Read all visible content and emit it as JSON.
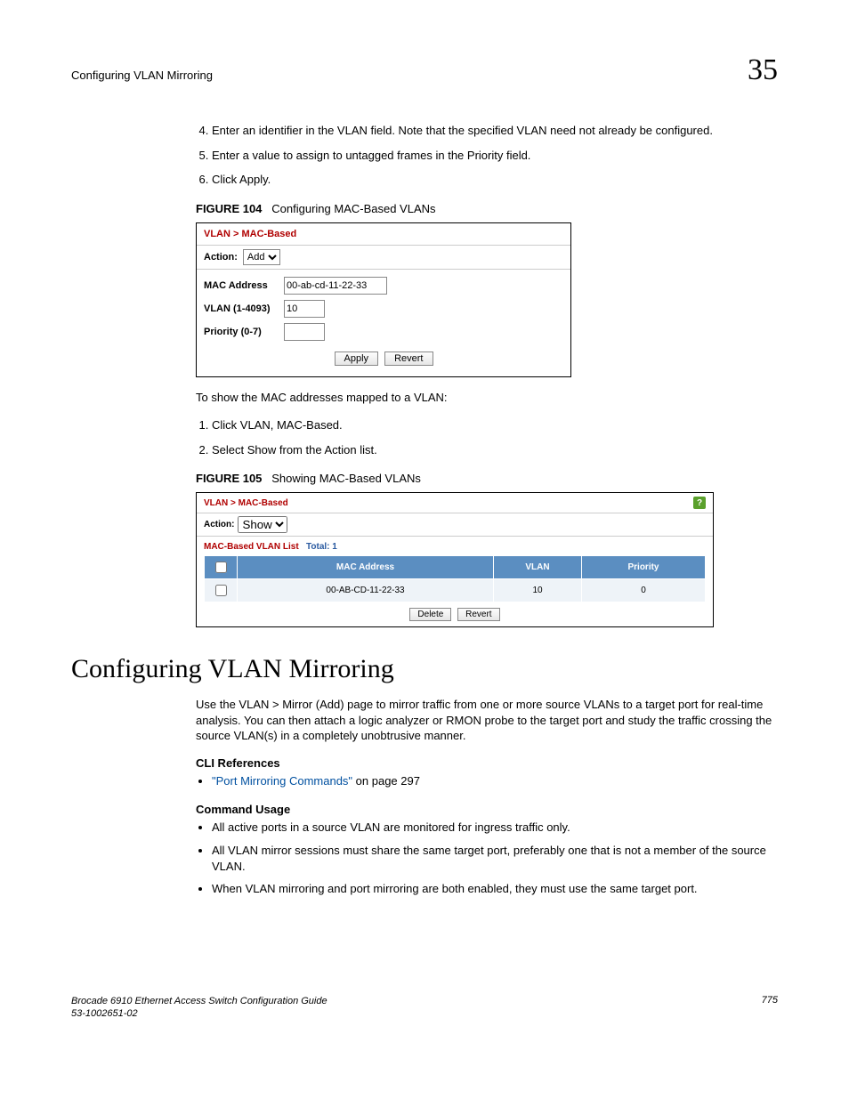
{
  "header": {
    "left": "Configuring VLAN Mirroring",
    "chapter": "35"
  },
  "steps_a": [
    "Enter an identifier in the VLAN field. Note that the specified VLAN need not already be configured.",
    "Enter a value to assign to untagged frames in the Priority field.",
    "Click Apply."
  ],
  "fig104": {
    "caption_label": "FIGURE 104",
    "caption_text": "Configuring MAC-Based VLANs",
    "breadcrumb": "VLAN > MAC-Based",
    "action_label": "Action:",
    "action_value": "Add",
    "fields": {
      "mac_label": "MAC Address",
      "mac_value": "00-ab-cd-11-22-33",
      "vlan_label": "VLAN (1-4093)",
      "vlan_value": "10",
      "prio_label": "Priority (0-7)",
      "prio_value": ""
    },
    "buttons": {
      "apply": "Apply",
      "revert": "Revert"
    }
  },
  "mid_text": "To show the MAC addresses mapped to a VLAN:",
  "steps_b": [
    "Click VLAN, MAC-Based.",
    "Select Show from the Action list."
  ],
  "fig105": {
    "caption_label": "FIGURE 105",
    "caption_text": "Showing MAC-Based VLANs",
    "breadcrumb": "VLAN > MAC-Based",
    "action_label": "Action:",
    "action_value": "Show",
    "list_title": "MAC-Based VLAN List",
    "total_label": "Total: 1",
    "cols": {
      "mac": "MAC Address",
      "vlan": "VLAN",
      "prio": "Priority"
    },
    "rows": [
      {
        "mac": "00-AB-CD-11-22-33",
        "vlan": "10",
        "prio": "0"
      }
    ],
    "buttons": {
      "delete": "Delete",
      "revert": "Revert"
    }
  },
  "section": {
    "title": "Configuring VLAN Mirroring",
    "intro": "Use the VLAN > Mirror (Add) page to mirror traffic from one or more source VLANs to a target port for real-time analysis. You can then attach a logic analyzer or RMON probe to the target port and study the traffic crossing the source VLAN(s) in a completely unobtrusive manner.",
    "cli_hdr": "CLI References",
    "cli_link": "\"Port Mirroring Commands\"",
    "cli_tail": " on page 297",
    "cmd_hdr": "Command Usage",
    "cmd_bullets": [
      "All active ports in a source VLAN are monitored for ingress traffic only.",
      "All VLAN mirror sessions must share the same target port, preferably one that is not a member of the source VLAN.",
      "When VLAN mirroring and port mirroring are both enabled, they must use the same target port."
    ]
  },
  "footer": {
    "line1": "Brocade 6910 Ethernet Access Switch Configuration Guide",
    "line2": "53-1002651-02",
    "page": "775"
  }
}
